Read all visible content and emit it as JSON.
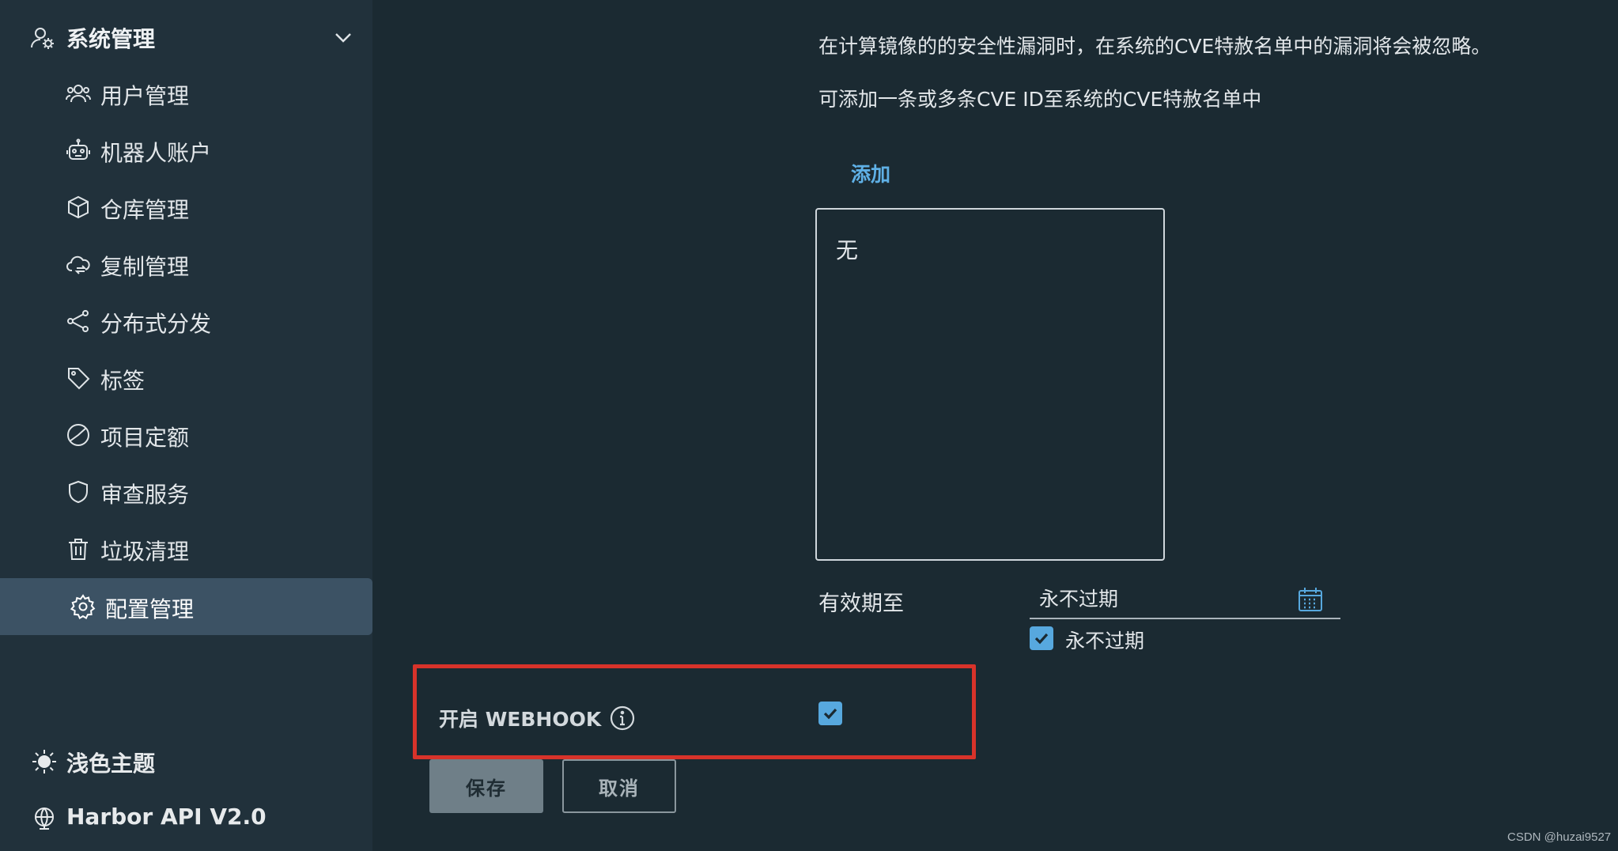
{
  "sidebar": {
    "group": {
      "label": "系统管理",
      "icon": "user-gear-icon",
      "expanded": true
    },
    "items": [
      {
        "label": "用户管理",
        "icon": "users-icon"
      },
      {
        "label": "机器人账户",
        "icon": "robot-icon"
      },
      {
        "label": "仓库管理",
        "icon": "box-icon"
      },
      {
        "label": "复制管理",
        "icon": "cloud-sync-icon"
      },
      {
        "label": "分布式分发",
        "icon": "share-icon"
      },
      {
        "label": "标签",
        "icon": "tag-icon"
      },
      {
        "label": "项目定额",
        "icon": "pie-chart-icon"
      },
      {
        "label": "审查服务",
        "icon": "shield-icon"
      },
      {
        "label": "垃圾清理",
        "icon": "trash-icon"
      },
      {
        "label": "配置管理",
        "icon": "gear-icon",
        "active": true
      }
    ],
    "theme_toggle": {
      "label": "浅色主题",
      "icon": "sun-icon"
    },
    "api_link": {
      "label": "Harbor API V2.0",
      "icon": "globe-icon"
    }
  },
  "cve": {
    "description": "在计算镜像的的安全性漏洞时，在系统的CVE特赦名单中的漏洞将会被忽略。",
    "hint": "可添加一条或多条CVE ID至系统的CVE特赦名单中",
    "add_label": "添加",
    "list_empty": "无",
    "expires_label": "有效期至",
    "expires_placeholder": "永不过期",
    "never_expires_label": "永不过期",
    "never_expires_checked": true
  },
  "webhook": {
    "label": "开启 WEBHOOK",
    "enabled": true
  },
  "actions": {
    "save_label": "保存",
    "cancel_label": "取消"
  },
  "watermark": "CSDN @huzai9527",
  "colors": {
    "background": "#1b2a32",
    "sidebar": "#21313b",
    "active_item": "#3c5264",
    "accent": "#57a8de",
    "link": "#5fb0e6",
    "highlight": "#d8332a"
  }
}
